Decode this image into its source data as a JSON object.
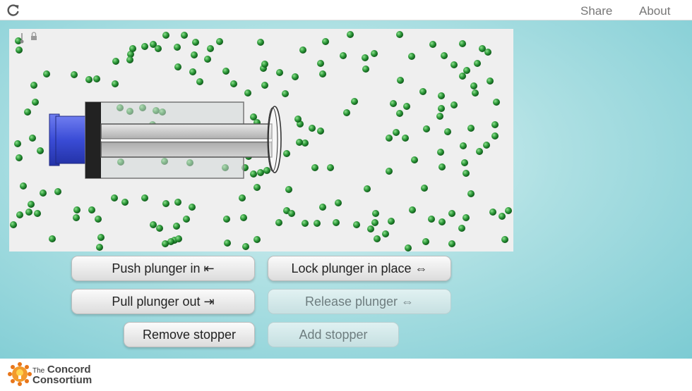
{
  "topbar": {
    "share_label": "Share",
    "about_label": "About"
  },
  "buttons": {
    "push": "Push plunger in ⇤",
    "lock": "Lock plunger in place ⇔",
    "pull": "Pull plunger out ⇥",
    "release": "Release plunger ⇔",
    "remove_stopper": "Remove stopper",
    "add_stopper": "Add stopper"
  },
  "footer": {
    "brand_the": "The",
    "brand_name": "Concord",
    "brand_sub": "Consortium"
  },
  "colors": {
    "molecule": "#2e9a3a",
    "plunger_blue": "#3a4cd6",
    "accent": "#7ccbd3"
  },
  "icons": [
    "reload-icon",
    "thermometer-icon",
    "lock-icon",
    "concord-logo"
  ]
}
